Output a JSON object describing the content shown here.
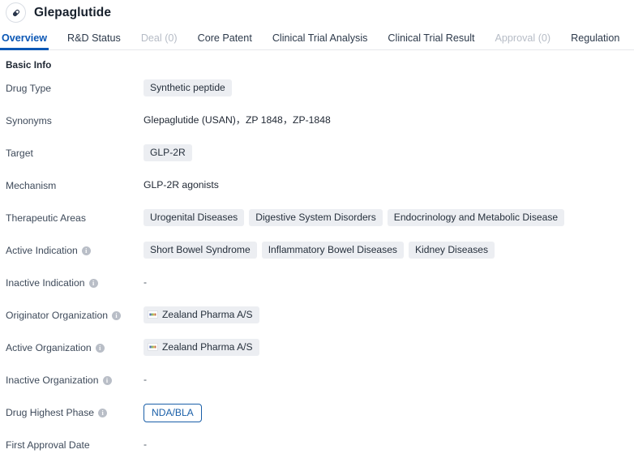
{
  "header": {
    "title": "Glepaglutide",
    "avatar_icon": "capsule-pill-icon"
  },
  "tabs": [
    {
      "label": "Overview",
      "state": "active"
    },
    {
      "label": "R&D Status",
      "state": "normal"
    },
    {
      "label": "Deal (0)",
      "state": "disabled"
    },
    {
      "label": "Core Patent",
      "state": "normal"
    },
    {
      "label": "Clinical Trial Analysis",
      "state": "normal"
    },
    {
      "label": "Clinical Trial Result",
      "state": "normal"
    },
    {
      "label": "Approval (0)",
      "state": "disabled"
    },
    {
      "label": "Regulation",
      "state": "normal"
    }
  ],
  "section": {
    "title": "Basic Info"
  },
  "rows": [
    {
      "label": "Drug Type",
      "has_info": false,
      "type": "tags",
      "tags": [
        "Synthetic peptide"
      ]
    },
    {
      "label": "Synonyms",
      "has_info": false,
      "type": "text",
      "text": "Glepaglutide (USAN)，ZP 1848，ZP-1848"
    },
    {
      "label": "Target",
      "has_info": false,
      "type": "tags",
      "tags": [
        "GLP-2R"
      ]
    },
    {
      "label": "Mechanism",
      "has_info": false,
      "type": "text",
      "text": "GLP-2R agonists"
    },
    {
      "label": "Therapeutic Areas",
      "has_info": false,
      "type": "tags",
      "tags": [
        "Urogenital Diseases",
        "Digestive System Disorders",
        "Endocrinology and Metabolic Disease"
      ]
    },
    {
      "label": "Active Indication",
      "has_info": true,
      "type": "tags",
      "tags": [
        "Short Bowel Syndrome",
        "Inflammatory Bowel Diseases",
        "Kidney Diseases"
      ]
    },
    {
      "label": "Inactive Indication",
      "has_info": true,
      "type": "empty",
      "text": "-"
    },
    {
      "label": "Originator Organization",
      "has_info": true,
      "type": "org-tags",
      "tags": [
        "Zealand Pharma A/S"
      ]
    },
    {
      "label": "Active Organization",
      "has_info": true,
      "type": "org-tags",
      "tags": [
        "Zealand Pharma A/S"
      ]
    },
    {
      "label": "Inactive Organization",
      "has_info": true,
      "type": "empty",
      "text": "-"
    },
    {
      "label": "Drug Highest Phase",
      "has_info": true,
      "type": "phase",
      "text": "NDA/BLA"
    },
    {
      "label": "First Approval Date",
      "has_info": false,
      "type": "empty",
      "text": "-"
    }
  ],
  "icons": {
    "info": "i",
    "org_logo": "company-logo-icon"
  },
  "colors": {
    "accent_blue": "#0b57b5",
    "phase_blue": "#1a5fa8",
    "tag_bg": "#eceef2",
    "label_text": "#3e4a5a",
    "disabled_tab": "#b6bcc6"
  }
}
